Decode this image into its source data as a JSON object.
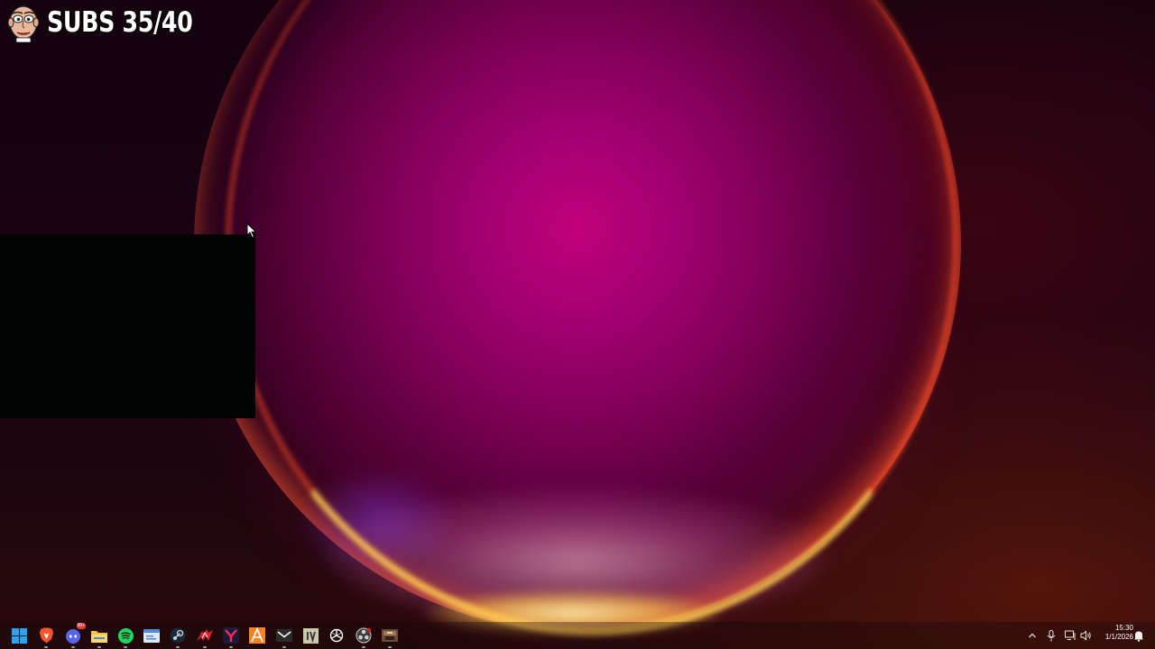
{
  "overlay": {
    "subs_label": "SUBS 35/40",
    "avatar_icon": "cartoon-face-avatar"
  },
  "taskbar": {
    "pinned": [
      {
        "name": "start-button",
        "icon": "windows-logo-icon",
        "color": "#2aa4f4"
      },
      {
        "name": "brave-browser",
        "icon": "brave-lion-icon",
        "color": "#fb542b"
      },
      {
        "name": "discord",
        "icon": "discord-icon",
        "color": "#5865f2",
        "badge": "99+"
      },
      {
        "name": "file-explorer",
        "icon": "folder-icon",
        "color": "#f6c342"
      },
      {
        "name": "spotify",
        "icon": "spotify-icon",
        "color": "#1ed760"
      },
      {
        "name": "app-window",
        "icon": "window-app-icon",
        "color": "#4f8ad8"
      },
      {
        "name": "steam",
        "icon": "steam-icon",
        "color": "#2c6e9f"
      },
      {
        "name": "msi-afterburner",
        "icon": "msi-dragon-icon",
        "color": "#d9222a"
      },
      {
        "name": "yahoo-app",
        "icon": "y-logo-icon",
        "color": "#c8102e"
      },
      {
        "name": "autodesk-app",
        "icon": "autodesk-a-icon",
        "color": "#f58220"
      },
      {
        "name": "mail-app",
        "icon": "envelope-icon",
        "color": "#2b2b2b"
      },
      {
        "name": "iv-app",
        "icon": "iv-logo-icon",
        "color": "#c9c9a8"
      },
      {
        "name": "chatgpt",
        "icon": "openai-knot-icon",
        "color": "#ffffff"
      },
      {
        "name": "obs-studio",
        "icon": "obs-record-icon",
        "color": "#3a3a3a"
      },
      {
        "name": "game-app",
        "icon": "game-thumbnail-icon",
        "color": "#6b4a3a"
      }
    ],
    "tray": [
      {
        "name": "show-hidden-icons",
        "icon": "chevron-up-icon"
      },
      {
        "name": "microphone",
        "icon": "microphone-icon"
      },
      {
        "name": "network",
        "icon": "network-icon"
      },
      {
        "name": "volume",
        "icon": "speaker-icon"
      }
    ],
    "clock": {
      "time": "15:30",
      "date": "1/1/2026"
    },
    "notifications_icon": "bell-icon"
  }
}
